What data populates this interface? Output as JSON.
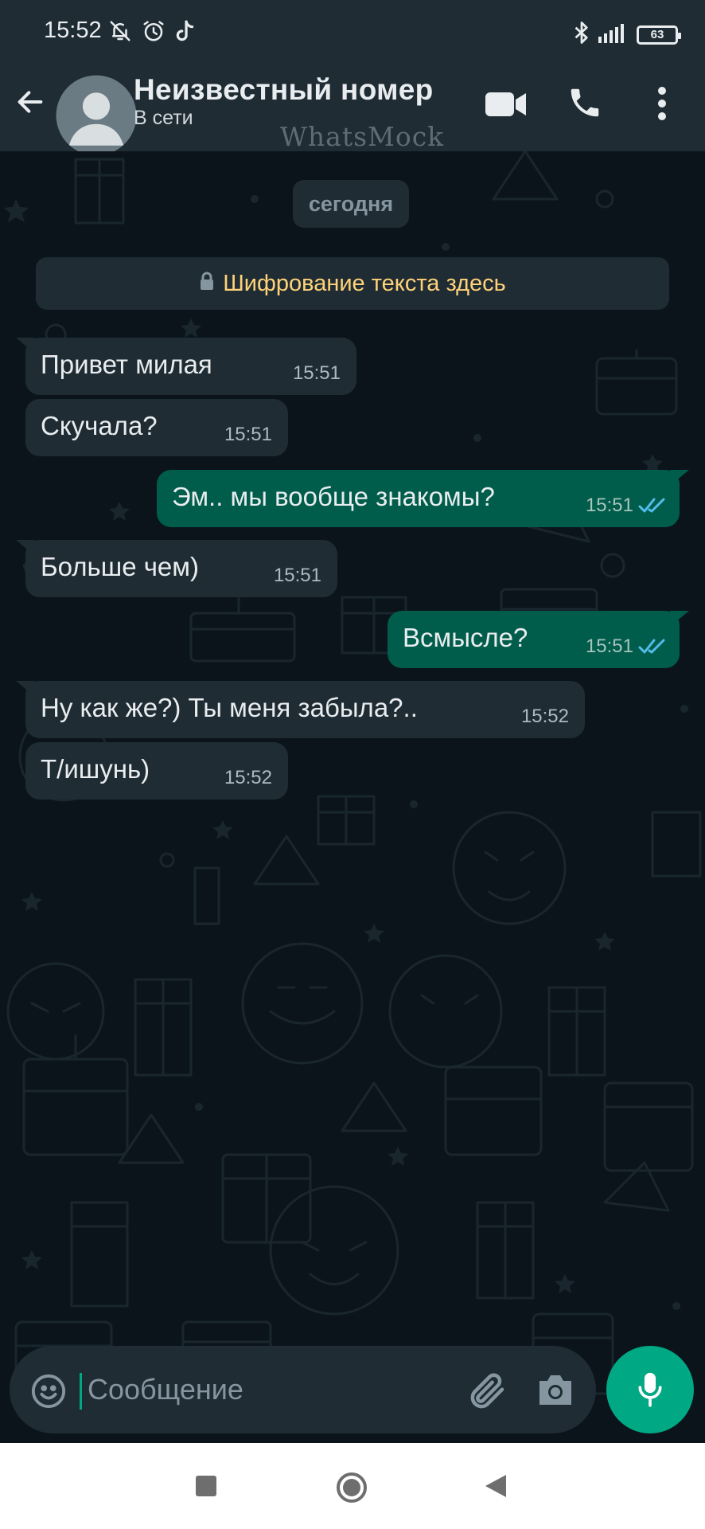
{
  "status_bar": {
    "time": "15:52",
    "battery": "63",
    "icons_left": [
      "bell-off-icon",
      "alarm-icon",
      "tiktok-icon"
    ],
    "icons_right": [
      "bluetooth-icon",
      "signal-icon",
      "battery-icon"
    ]
  },
  "header": {
    "contact_name": "Неизвестный номер",
    "status": "В сети",
    "watermark": "WhatsMock",
    "icons": [
      "back-arrow-icon",
      "avatar-placeholder-icon",
      "video-call-icon",
      "phone-icon",
      "more-vert-icon"
    ]
  },
  "chat": {
    "date_chip": "сегодня",
    "encryption_banner": "Шифрование текста здесь",
    "messages": [
      {
        "direction": "incoming",
        "text": "Привет милая",
        "time": "15:51"
      },
      {
        "direction": "incoming",
        "text": "Скучала?",
        "time": "15:51"
      },
      {
        "direction": "outgoing",
        "text": "Эм.. мы вообще знакомы?",
        "time": "15:51",
        "status": "read"
      },
      {
        "direction": "incoming",
        "text": "Больше чем)",
        "time": "15:51"
      },
      {
        "direction": "outgoing",
        "text": "Всмысле?",
        "time": "15:51",
        "status": "read"
      },
      {
        "direction": "incoming",
        "text": "Ну как же?) Ты меня забыла?..",
        "time": "15:52"
      },
      {
        "direction": "incoming",
        "text": "Т/ишунь)",
        "time": "15:52"
      }
    ]
  },
  "composer": {
    "placeholder": "Сообщение",
    "value": "",
    "icons": [
      "emoji-icon",
      "attach-icon",
      "camera-icon",
      "mic-icon"
    ]
  },
  "nav_bar": {
    "icons": [
      "recents-icon",
      "home-icon",
      "back-icon"
    ]
  },
  "colors": {
    "background": "#0b141a",
    "bar": "#1f2c34",
    "incoming_bubble": "#1f2c34",
    "outgoing_bubble": "#005c4b",
    "accent": "#00a884",
    "encryption_text": "#ffd279",
    "read_ticks": "#53bdeb"
  }
}
